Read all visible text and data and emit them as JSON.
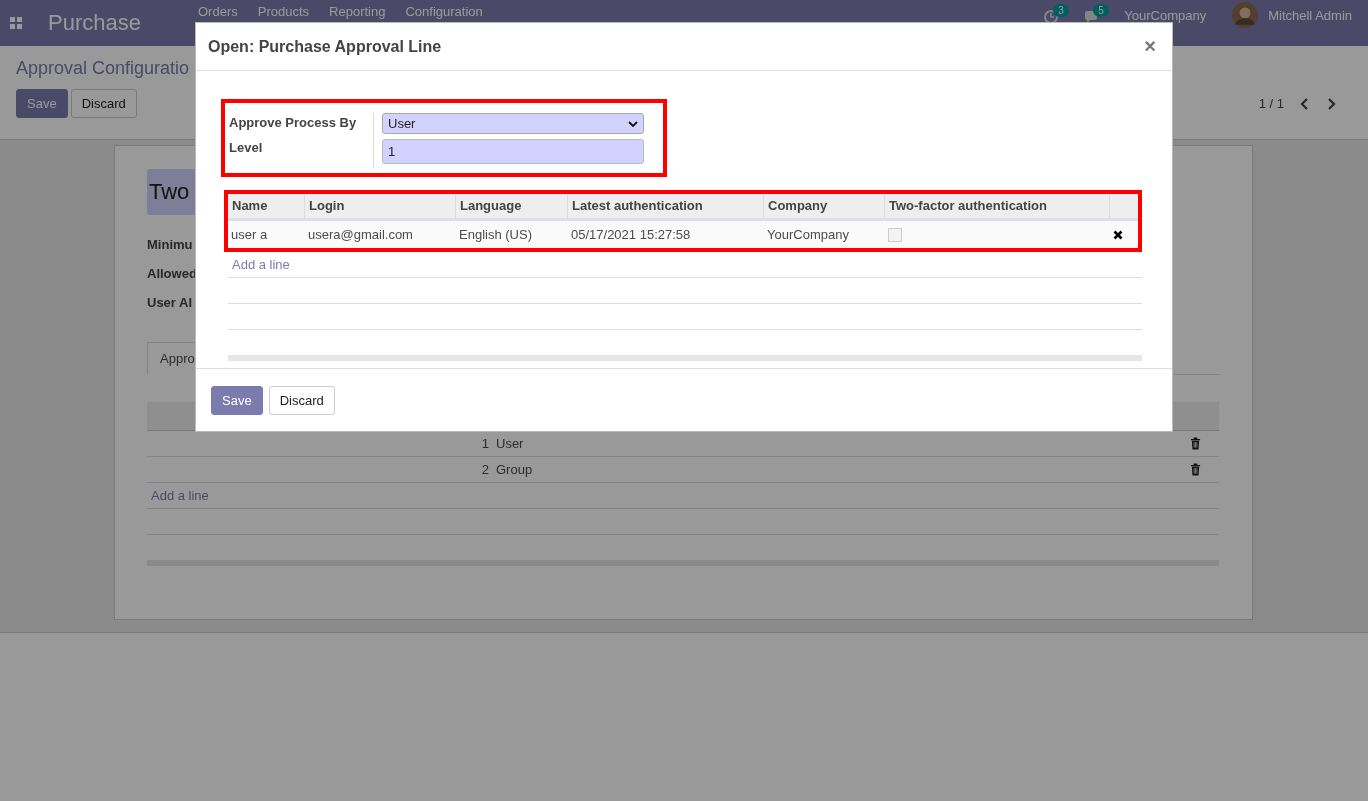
{
  "navbar": {
    "app_name": "Purchase",
    "menu": [
      "Orders",
      "Products",
      "Reporting",
      "Configuration"
    ],
    "activity_count": "3",
    "message_count": "5",
    "company": "YourCompany",
    "user": "Mitchell Admin"
  },
  "control_panel": {
    "breadcrumb": "Approval Configuratio",
    "buttons": [
      "Save",
      "Discard"
    ],
    "pager": "1 / 1"
  },
  "form": {
    "name": "Two",
    "labels": [
      "Minimu",
      "Allowed",
      "User Al"
    ],
    "tabs": [
      {
        "label": "Appro",
        "selected": true
      }
    ],
    "lines": [
      {
        "level": "1",
        "approve_by": "User"
      },
      {
        "level": "2",
        "approve_by": "Group"
      }
    ],
    "add_line": "Add a line"
  },
  "dialog": {
    "title": "Open: Purchase Approval Line",
    "close": "×",
    "fields": [
      {
        "label": "Approve Process By",
        "kind": "select",
        "value": "User"
      },
      {
        "label": "Level",
        "kind": "input",
        "value": "1"
      }
    ],
    "table": {
      "columns": [
        "Name",
        "Login",
        "Language",
        "Latest authentication",
        "Company",
        "Two-factor authentication"
      ],
      "rows": [
        {
          "cells": [
            "user a",
            "usera@gmail.com",
            "English (US)",
            "05/17/2021 15:27:58",
            "YourCompany"
          ],
          "two_factor": false
        }
      ]
    },
    "add_line": "Add a line",
    "buttons": [
      "Save",
      "Discard"
    ]
  }
}
